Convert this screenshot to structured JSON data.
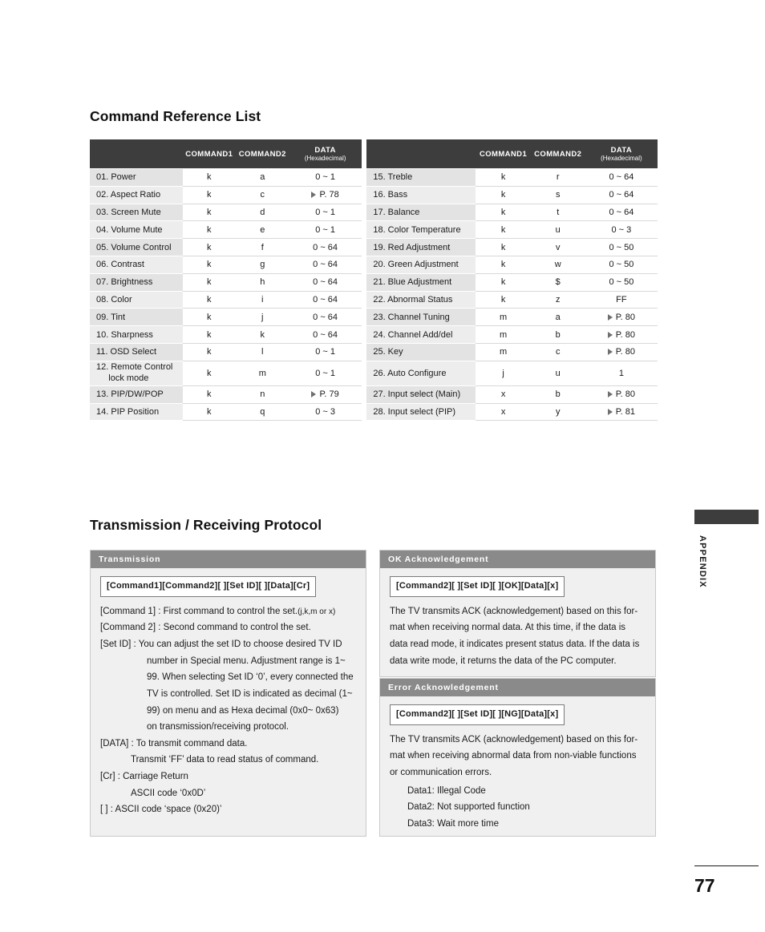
{
  "sections": {
    "command_title": "Command Reference List",
    "protocol_title": "Transmission / Receiving Protocol"
  },
  "command_table": {
    "headers": {
      "blank": "",
      "command1": "COMMAND1",
      "command2": "COMMAND2",
      "data_main": "DATA",
      "data_sub": "(Hexadecimal)"
    },
    "left_rows": [
      {
        "name": "01. Power",
        "c1": "k",
        "c2": "a",
        "data": "0 ~ 1",
        "link": false
      },
      {
        "name": "02. Aspect Ratio",
        "c1": "k",
        "c2": "c",
        "data": "P. 78",
        "link": true
      },
      {
        "name": "03. Screen Mute",
        "c1": "k",
        "c2": "d",
        "data": "0 ~ 1",
        "link": false
      },
      {
        "name": "04. Volume Mute",
        "c1": "k",
        "c2": "e",
        "data": "0 ~ 1",
        "link": false
      },
      {
        "name": "05. Volume Control",
        "c1": "k",
        "c2": "f",
        "data": "0 ~ 64",
        "link": false
      },
      {
        "name": "06. Contrast",
        "c1": "k",
        "c2": "g",
        "data": "0 ~ 64",
        "link": false
      },
      {
        "name": "07. Brightness",
        "c1": "k",
        "c2": "h",
        "data": "0 ~ 64",
        "link": false
      },
      {
        "name": "08. Color",
        "c1": "k",
        "c2": "i",
        "data": "0 ~ 64",
        "link": false
      },
      {
        "name": "09. Tint",
        "c1": "k",
        "c2": "j",
        "data": "0 ~ 64",
        "link": false
      },
      {
        "name": "10. Sharpness",
        "c1": "k",
        "c2": "k",
        "data": "0 ~ 64",
        "link": false
      },
      {
        "name": "11. OSD Select",
        "c1": "k",
        "c2": "l",
        "data": "0 ~ 1",
        "link": false
      },
      {
        "name": "12. Remote Control lock mode",
        "c1": "k",
        "c2": "m",
        "data": "0 ~ 1",
        "link": false
      },
      {
        "name": "13. PIP/DW/POP",
        "c1": "k",
        "c2": "n",
        "data": "P. 79",
        "link": true
      },
      {
        "name": "14. PIP Position",
        "c1": "k",
        "c2": "q",
        "data": "0 ~ 3",
        "link": false
      }
    ],
    "right_rows": [
      {
        "name": "15. Treble",
        "c1": "k",
        "c2": "r",
        "data": "0 ~ 64",
        "link": false
      },
      {
        "name": "16. Bass",
        "c1": "k",
        "c2": "s",
        "data": "0 ~ 64",
        "link": false
      },
      {
        "name": "17. Balance",
        "c1": "k",
        "c2": "t",
        "data": "0 ~ 64",
        "link": false
      },
      {
        "name": "18. Color Temperature",
        "c1": "k",
        "c2": "u",
        "data": "0 ~ 3",
        "link": false
      },
      {
        "name": "19. Red Adjustment",
        "c1": "k",
        "c2": "v",
        "data": "0 ~ 50",
        "link": false
      },
      {
        "name": "20. Green Adjustment",
        "c1": "k",
        "c2": "w",
        "data": "0 ~ 50",
        "link": false
      },
      {
        "name": "21. Blue Adjustment",
        "c1": "k",
        "c2": "$",
        "data": "0 ~ 50",
        "link": false
      },
      {
        "name": "22. Abnormal Status",
        "c1": "k",
        "c2": "z",
        "data": "FF",
        "link": false
      },
      {
        "name": "23. Channel Tuning",
        "c1": "m",
        "c2": "a",
        "data": "P. 80",
        "link": true
      },
      {
        "name": "24. Channel Add/del",
        "c1": "m",
        "c2": "b",
        "data": "P. 80",
        "link": true
      },
      {
        "name": "25. Key",
        "c1": "m",
        "c2": "c",
        "data": "P. 80",
        "link": true
      },
      {
        "name": "26. Auto Configure",
        "c1": "j",
        "c2": "u",
        "data": "1",
        "link": false
      },
      {
        "name": "27. Input select (Main)",
        "c1": "x",
        "c2": "b",
        "data": "P. 80",
        "link": true
      },
      {
        "name": "28. Input select (PIP)",
        "c1": "x",
        "c2": "y",
        "data": "P. 81",
        "link": true
      }
    ]
  },
  "transmission": {
    "header": "Transmission",
    "syntax": "[Command1][Command2][ ][Set ID][ ][Data][Cr]",
    "lines": {
      "l1": "[Command 1] : First command to control the set.",
      "l1_small": "(j,k,m or x)",
      "l2": "[Command 2] : Second command to control the set.",
      "l3": "[Set ID] : You can adjust the set ID to choose desired TV ID",
      "l4": "number in Special menu. Adjustment range is 1~",
      "l5": "99. When selecting Set ID ‘0’, every connected the",
      "l6": "TV is controlled. Set ID is indicated as decimal (1~",
      "l7": "99) on menu and as Hexa decimal (0x0~ 0x63)",
      "l8": "on transmission/receiving protocol.",
      "l9": "[DATA] : To transmit command data.",
      "l10": "Transmit ‘FF’ data to read status of command.",
      "l11": "[Cr] : Carriage Return",
      "l12": "ASCII code ‘0x0D’",
      "l13": "[    ] : ASCII code ‘space (0x20)’"
    }
  },
  "ok_ack": {
    "header": "OK Acknowledgement",
    "syntax": "[Command2][ ][Set ID][ ][OK][Data][x]",
    "lines": {
      "l1": "The TV transmits ACK (acknowledgement) based on this for-",
      "l2": "mat when receiving normal data. At this time, if the data is",
      "l3": "data read mode, it indicates present status data. If the data is",
      "l4": "data write mode, it returns the data of the PC computer."
    }
  },
  "error_ack": {
    "header": "Error Acknowledgement",
    "syntax": "[Command2][ ][Set ID][ ][NG][Data][x]",
    "lines": {
      "l1": "The TV transmits ACK (acknowledgement) based on this for-",
      "l2": "mat when receiving abnormal data from non-viable functions",
      "l3": "or communication errors.",
      "d1": "Data1: Illegal Code",
      "d2": "Data2: Not supported function",
      "d3": "Data3: Wait more time"
    }
  },
  "page": {
    "appendix_label": "APPENDIX",
    "number": "77"
  }
}
